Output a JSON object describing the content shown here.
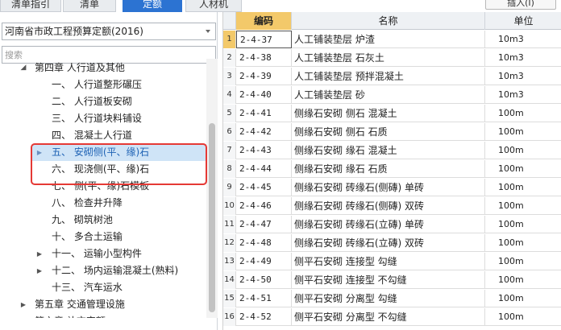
{
  "tabs": [
    {
      "label": "清单指引",
      "active": false
    },
    {
      "label": "清单",
      "active": false
    },
    {
      "label": "定额",
      "active": true
    },
    {
      "label": "人材机",
      "active": false
    }
  ],
  "insert_label": "插入(I)",
  "quota_select": {
    "value": "河南省市政工程预算定额(2016)"
  },
  "search": {
    "placeholder": "搜索"
  },
  "tree": [
    {
      "label": "第四章 人行道及其他",
      "toggle": "open",
      "selected": false
    },
    {
      "label": "一、 人行道整形碾压",
      "toggle": "",
      "selected": false
    },
    {
      "label": "二、 人行道板安砌",
      "toggle": "",
      "selected": false
    },
    {
      "label": "三、 人行道块料铺设",
      "toggle": "",
      "selected": false
    },
    {
      "label": "四、 混凝土人行道",
      "toggle": "",
      "selected": false
    },
    {
      "label": "五、 安砌侧(平、缘)石",
      "toggle": "closed",
      "selected": true
    },
    {
      "label": "六、 现浇侧(平、缘)石",
      "toggle": "",
      "selected": false
    },
    {
      "label": "七、 侧(平、缘)石模板",
      "toggle": "",
      "selected": false
    },
    {
      "label": "八、 检查井升降",
      "toggle": "",
      "selected": false
    },
    {
      "label": "九、 砌筑树池",
      "toggle": "",
      "selected": false
    },
    {
      "label": "十、 多合土运输",
      "toggle": "",
      "selected": false
    },
    {
      "label": "十一、 运输小型构件",
      "toggle": "closed",
      "selected": false
    },
    {
      "label": "十二、 场内运输混凝土(熟料)",
      "toggle": "closed",
      "selected": false
    },
    {
      "label": "十三、 汽车运水",
      "toggle": "",
      "selected": false
    },
    {
      "label": "第五章 交通管理设施",
      "toggle": "closed",
      "selected": false
    },
    {
      "label": "第六章 补充定额",
      "toggle": "closed",
      "selected": false
    }
  ],
  "grid": {
    "headers": {
      "code": "编码",
      "name": "名称",
      "unit": "单位"
    },
    "rows": [
      {
        "idx": "1",
        "code": "2-4-37",
        "name": "人工铺装垫层 炉渣",
        "unit": "10m3"
      },
      {
        "idx": "2",
        "code": "2-4-38",
        "name": "人工铺装垫层 石灰土",
        "unit": "10m3"
      },
      {
        "idx": "3",
        "code": "2-4-39",
        "name": "人工铺装垫层 预拌混凝土",
        "unit": "10m3"
      },
      {
        "idx": "4",
        "code": "2-4-40",
        "name": "人工铺装垫层 砂",
        "unit": "10m3"
      },
      {
        "idx": "5",
        "code": "2-4-41",
        "name": "侧缘石安砌 侧石 混凝土",
        "unit": "100m"
      },
      {
        "idx": "6",
        "code": "2-4-42",
        "name": "侧缘石安砌 侧石 石质",
        "unit": "100m"
      },
      {
        "idx": "7",
        "code": "2-4-43",
        "name": "侧缘石安砌 缘石 混凝土",
        "unit": "100m"
      },
      {
        "idx": "8",
        "code": "2-4-44",
        "name": "侧缘石安砌 缘石 石质",
        "unit": "100m"
      },
      {
        "idx": "9",
        "code": "2-4-45",
        "name": "侧缘石安砌 砖缘石(侧磚) 单砖",
        "unit": "100m"
      },
      {
        "idx": "10",
        "code": "2-4-46",
        "name": "侧缘石安砌 砖缘石(侧磚) 双砖",
        "unit": "100m"
      },
      {
        "idx": "11",
        "code": "2-4-47",
        "name": "侧缘石安砌 砖缘石(立磚) 单砖",
        "unit": "100m"
      },
      {
        "idx": "12",
        "code": "2-4-48",
        "name": "侧缘石安砌 砖缘石(立磚) 双砖",
        "unit": "100m"
      },
      {
        "idx": "13",
        "code": "2-4-49",
        "name": "侧平石安砌 连接型 勾缝",
        "unit": "100m"
      },
      {
        "idx": "14",
        "code": "2-4-50",
        "name": "侧平石安砌 连接型 不勾缝",
        "unit": "100m"
      },
      {
        "idx": "15",
        "code": "2-4-51",
        "name": "侧平石安砌 分离型 勾缝",
        "unit": "100m"
      },
      {
        "idx": "16",
        "code": "2-4-52",
        "name": "侧平石安砌 分离型 不勾缝",
        "unit": "100m"
      }
    ]
  },
  "colors": {
    "accent": "#2c73d2",
    "highlight": "#e53935",
    "code_header": "#f3c96a",
    "selected_row": "#cfe4f7"
  }
}
